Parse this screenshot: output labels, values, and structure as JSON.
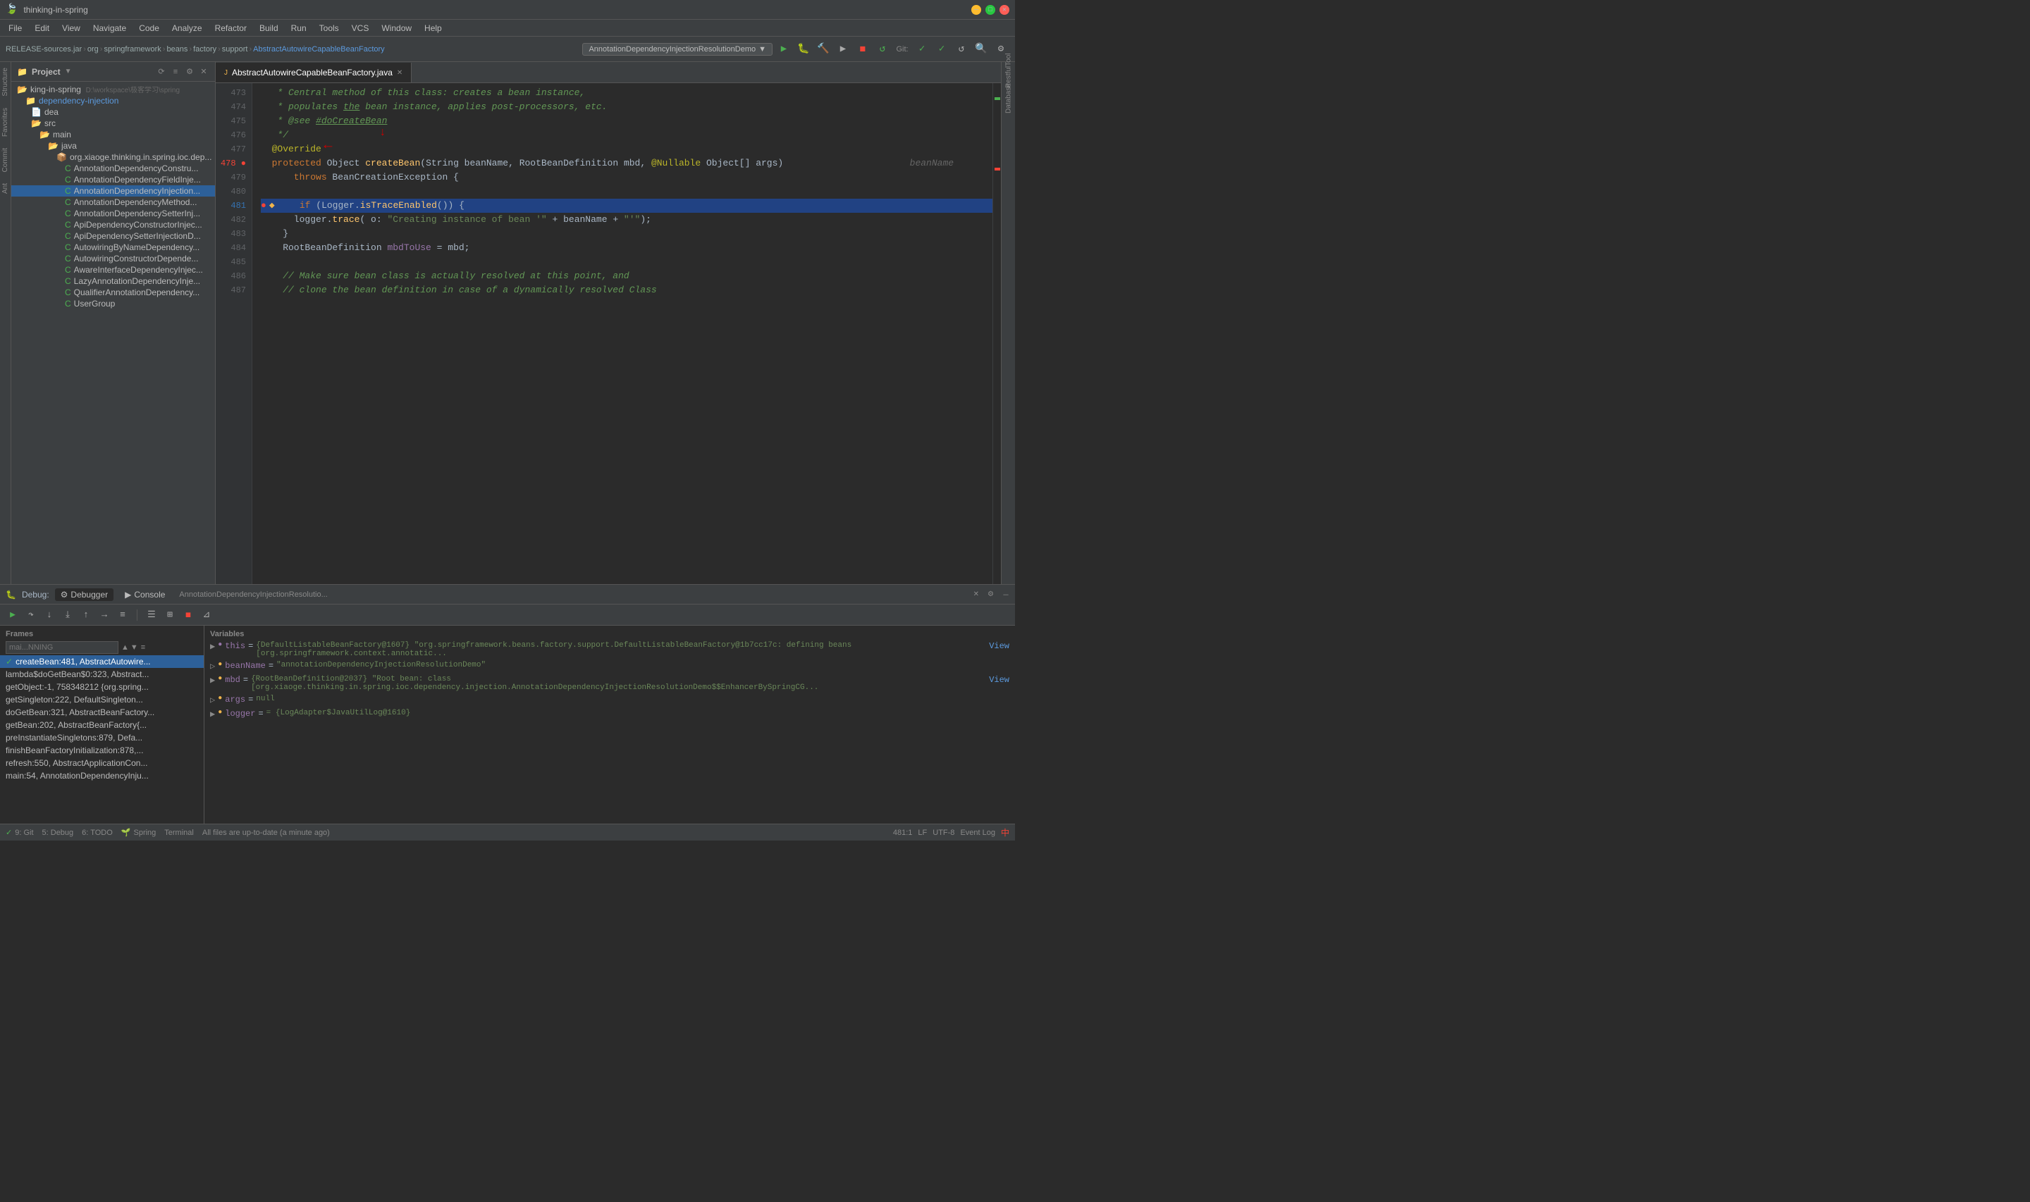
{
  "window": {
    "title": "thinking-in-spring",
    "controls": [
      "close",
      "minimize",
      "maximize"
    ]
  },
  "menu": {
    "items": [
      "File",
      "Edit",
      "View",
      "Navigate",
      "Code",
      "Analyze",
      "Refactor",
      "Build",
      "Run",
      "Tools",
      "VCS",
      "Window",
      "Help"
    ]
  },
  "toolbar": {
    "breadcrumb": [
      "RELEASE-sources.jar",
      "org",
      "springframework",
      "beans",
      "factory",
      "support",
      "AbstractAutowireCapableBeanFactory"
    ],
    "run_config": "AnnotationDependencyInjectionResolutionDemo",
    "git_label": "Git:"
  },
  "project": {
    "title": "Project",
    "root_label": "king-in-spring",
    "root_path": "D:\\workspace\\极客学习\\spring",
    "module": "dependency-injection",
    "items": [
      {
        "label": "src",
        "type": "folder",
        "indent": 2
      },
      {
        "label": "main",
        "type": "folder",
        "indent": 3
      },
      {
        "label": "java",
        "type": "folder",
        "indent": 4
      },
      {
        "label": "org.xiaoge.thinking.in.spring.ioc.dep",
        "type": "package",
        "indent": 5
      },
      {
        "label": "AnnotationDependencyConstru...",
        "type": "class",
        "indent": 6
      },
      {
        "label": "AnnotationDependencyFieldInje...",
        "type": "class",
        "indent": 6
      },
      {
        "label": "AnnotationDependencyInjection...",
        "type": "class",
        "indent": 6,
        "selected": true
      },
      {
        "label": "AnnotationDependencyMethod...",
        "type": "class",
        "indent": 6
      },
      {
        "label": "AnnotationDependencySetterInj...",
        "type": "class",
        "indent": 6
      },
      {
        "label": "ApiDependencyConstructorInjec...",
        "type": "class",
        "indent": 6
      },
      {
        "label": "ApiDependencySetterInjectionD...",
        "type": "class",
        "indent": 6
      },
      {
        "label": "AutowiringByNameDependency...",
        "type": "class",
        "indent": 6
      },
      {
        "label": "AutowiringConstructorDepende...",
        "type": "class",
        "indent": 6
      },
      {
        "label": "AwareInterfaceDependencyInjec...",
        "type": "class",
        "indent": 6
      },
      {
        "label": "LazyAnnotationDependencyInje...",
        "type": "class",
        "indent": 6
      },
      {
        "label": "QualifierAnnotationDependency...",
        "type": "class",
        "indent": 6
      },
      {
        "label": "UserGroup",
        "type": "class",
        "indent": 6
      }
    ]
  },
  "editor": {
    "tab": {
      "label": "AbstractAutowireCapableBeanFactory.java",
      "icon": "J"
    },
    "lines": [
      {
        "num": 473,
        "content": "   * Central method of this class: creates a bean instance,",
        "type": "comment"
      },
      {
        "num": 474,
        "content": "   * populates the bean instance, applies post-processors, etc.",
        "type": "comment"
      },
      {
        "num": 475,
        "content": "   * @see #doCreateBean",
        "type": "comment"
      },
      {
        "num": 476,
        "content": "   */",
        "type": "comment"
      },
      {
        "num": 477,
        "content": "  @Override",
        "type": "annotation"
      },
      {
        "num": 478,
        "content": "  protected Object createBean(String beanName, RootBeanDefinition mbd, @Nullable Object[] args)   beanName",
        "type": "code",
        "has_breakpoint": true
      },
      {
        "num": 479,
        "content": "      throws BeanCreationException {",
        "type": "code"
      },
      {
        "num": 480,
        "content": "",
        "type": "blank"
      },
      {
        "num": 481,
        "content": "    if (Logger.isTraceEnabled()) {",
        "type": "code",
        "highlighted": true,
        "has_bookmark": true
      },
      {
        "num": 482,
        "content": "      logger.trace( o: \"Creating instance of bean '\" + beanName + \"'\");",
        "type": "code"
      },
      {
        "num": 483,
        "content": "    }",
        "type": "code"
      },
      {
        "num": 484,
        "content": "    RootBeanDefinition mbdToUse = mbd;",
        "type": "code"
      },
      {
        "num": 485,
        "content": "",
        "type": "blank"
      },
      {
        "num": 486,
        "content": "    // Make sure bean class is actually resolved at this point, and",
        "type": "comment_inline"
      },
      {
        "num": 487,
        "content": "    // clone the bean definition in case of a dynamically resolved Class",
        "type": "comment_inline"
      }
    ]
  },
  "debug": {
    "header_label": "Debug:",
    "session_label": "AnnotationDependencyInjectionResolutio...",
    "tabs": [
      "Debugger",
      "Console"
    ],
    "toolbar_buttons": [
      "resume",
      "step-over",
      "step-into",
      "step-out",
      "run-to-cursor",
      "evaluate"
    ],
    "frames_title": "Frames",
    "variables_title": "Variables",
    "frames": [
      {
        "label": "createBean:481, AbstractAutowire...",
        "active": true
      },
      {
        "label": "lambda$doGetBean$0:323, Abstract..."
      },
      {
        "label": "getObject:-1, 758348212 {org.spring..."
      },
      {
        "label": "getSingleton:222, DefaultSingleton..."
      },
      {
        "label": "doGetBean:321, AbstractBeanFactory..."
      },
      {
        "label": "getBean:202, AbstractBeanFactory{..."
      },
      {
        "label": "preInstantiateSingletons:879, Defa..."
      },
      {
        "label": "finishBeanFactoryInitialization:878,..."
      },
      {
        "label": "refresh:550, AbstractApplicationCon..."
      },
      {
        "label": "main:54, AnnotationDependencyInju..."
      }
    ],
    "variables": [
      {
        "key": "this",
        "expand": true,
        "icon": "obj",
        "value": "{DefaultListableBeanFactory@1607} \"org.springframework.beans.factory.support.DefaultListableBeanFactory@1b7cc17c: defining beans [org.springframework.context.annotatic...",
        "has_link": true
      },
      {
        "key": "beanName",
        "expand": false,
        "icon": "str",
        "value": "= \"annotationDependencyInjectionResolutionDemo\""
      },
      {
        "key": "mbd",
        "expand": true,
        "icon": "obj",
        "value": "{RootBeanDefinition@2037} \"Root bean: class [org.xiaoge.thinking.in.spring.ioc.dependency.injection.AnnotationDependencyInjectionResolutionDemo$$EnhancerBySpringCG...",
        "has_link": true
      },
      {
        "key": "args",
        "expand": false,
        "icon": "obj",
        "value": "= null"
      },
      {
        "key": "logger",
        "expand": true,
        "icon": "obj",
        "value": "= {LogAdapter$JavaUtilLog@1610}"
      }
    ]
  },
  "status_bar": {
    "git_icon": "9: Git",
    "debug_icon": "5: Debug",
    "todo_icon": "6: TODO",
    "spring_icon": "Spring",
    "terminal_icon": "Terminal",
    "message": "All files are up-to-date (a minute ago)",
    "position": "481:1",
    "encoding": "LF",
    "indent": "UTF-8",
    "event_log": "Event Log"
  }
}
